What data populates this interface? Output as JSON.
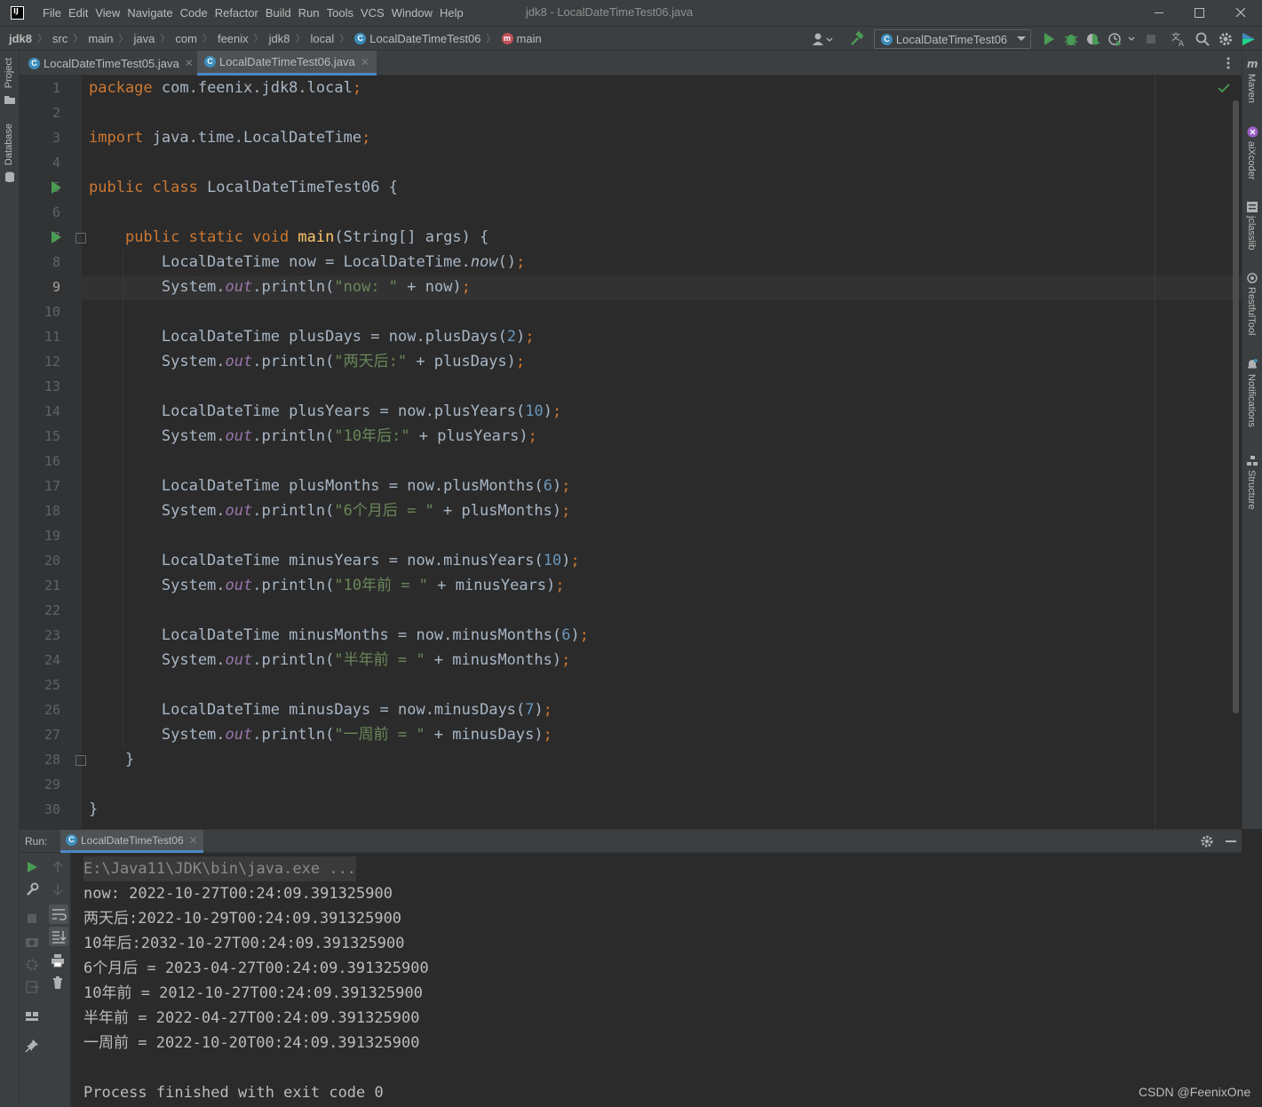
{
  "window": {
    "title": "jdk8 - LocalDateTimeTest06.java",
    "logo_text": "IJ"
  },
  "menu": [
    "File",
    "Edit",
    "View",
    "Navigate",
    "Code",
    "Refactor",
    "Build",
    "Run",
    "Tools",
    "VCS",
    "Window",
    "Help"
  ],
  "breadcrumb": [
    "jdk8",
    "src",
    "main",
    "java",
    "com",
    "feenix",
    "jdk8",
    "local",
    "LocalDateTimeTest06",
    "main"
  ],
  "toolbar": {
    "run_config": "LocalDateTimeTest06"
  },
  "left_tools": [
    "Project",
    "Database"
  ],
  "right_tools": [
    "Maven",
    "aiXcoder",
    "jclasslib",
    "RestfulTool",
    "Notifications",
    "Structure"
  ],
  "tabs": [
    {
      "label": "LocalDateTimeTest05.java",
      "active": false
    },
    {
      "label": "LocalDateTimeTest06.java",
      "active": true
    }
  ],
  "editor": {
    "current_line": 9,
    "line_numbers": [
      "1",
      "2",
      "3",
      "4",
      "5",
      "6",
      "7",
      "8",
      "9",
      "10",
      "11",
      "12",
      "13",
      "14",
      "15",
      "16",
      "17",
      "18",
      "19",
      "20",
      "21",
      "22",
      "23",
      "24",
      "25",
      "26",
      "27",
      "28",
      "29",
      "30"
    ],
    "lines": [
      [
        [
          "kw",
          "package "
        ],
        [
          "pl",
          "com.feenix.jdk8.local"
        ],
        [
          "kw",
          ";"
        ]
      ],
      [],
      [
        [
          "kw",
          "import "
        ],
        [
          "pl",
          "java.time.LocalDateTime"
        ],
        [
          "kw",
          ";"
        ]
      ],
      [],
      [
        [
          "kw",
          "public class "
        ],
        [
          "pl",
          "LocalDateTimeTest06 {"
        ]
      ],
      [],
      [
        [
          "pl",
          "    "
        ],
        [
          "kw",
          "public static void "
        ],
        [
          "fn",
          "main"
        ],
        [
          "pl",
          "(String[] args) {"
        ]
      ],
      [
        [
          "pl",
          "        LocalDateTime now = LocalDateTime."
        ],
        [
          "sm",
          "now"
        ],
        [
          "pl",
          "()"
        ],
        [
          "kw",
          ";"
        ]
      ],
      [
        [
          "pl",
          "        System."
        ],
        [
          "it",
          "out"
        ],
        [
          "pl",
          ".println("
        ],
        [
          "st",
          "\"now: \""
        ],
        [
          "pl",
          " + now)"
        ],
        [
          "kw",
          ";"
        ]
      ],
      [],
      [
        [
          "pl",
          "        LocalDateTime plusDays = now.plusDays("
        ],
        [
          "num",
          "2"
        ],
        [
          "pl",
          ")"
        ],
        [
          "kw",
          ";"
        ]
      ],
      [
        [
          "pl",
          "        System."
        ],
        [
          "it",
          "out"
        ],
        [
          "pl",
          ".println("
        ],
        [
          "st",
          "\"两天后:\""
        ],
        [
          "pl",
          " + plusDays)"
        ],
        [
          "kw",
          ";"
        ]
      ],
      [],
      [
        [
          "pl",
          "        LocalDateTime plusYears = now.plusYears("
        ],
        [
          "num",
          "10"
        ],
        [
          "pl",
          ")"
        ],
        [
          "kw",
          ";"
        ]
      ],
      [
        [
          "pl",
          "        System."
        ],
        [
          "it",
          "out"
        ],
        [
          "pl",
          ".println("
        ],
        [
          "st",
          "\"10年后:\""
        ],
        [
          "pl",
          " + plusYears)"
        ],
        [
          "kw",
          ";"
        ]
      ],
      [],
      [
        [
          "pl",
          "        LocalDateTime plusMonths = now.plusMonths("
        ],
        [
          "num",
          "6"
        ],
        [
          "pl",
          ")"
        ],
        [
          "kw",
          ";"
        ]
      ],
      [
        [
          "pl",
          "        System."
        ],
        [
          "it",
          "out"
        ],
        [
          "pl",
          ".println("
        ],
        [
          "st",
          "\"6个月后 = \""
        ],
        [
          "pl",
          " + plusMonths)"
        ],
        [
          "kw",
          ";"
        ]
      ],
      [],
      [
        [
          "pl",
          "        LocalDateTime minusYears = now.minusYears("
        ],
        [
          "num",
          "10"
        ],
        [
          "pl",
          ")"
        ],
        [
          "kw",
          ";"
        ]
      ],
      [
        [
          "pl",
          "        System."
        ],
        [
          "it",
          "out"
        ],
        [
          "pl",
          ".println("
        ],
        [
          "st",
          "\"10年前 = \""
        ],
        [
          "pl",
          " + minusYears)"
        ],
        [
          "kw",
          ";"
        ]
      ],
      [],
      [
        [
          "pl",
          "        LocalDateTime minusMonths = now.minusMonths("
        ],
        [
          "num",
          "6"
        ],
        [
          "pl",
          ")"
        ],
        [
          "kw",
          ";"
        ]
      ],
      [
        [
          "pl",
          "        System."
        ],
        [
          "it",
          "out"
        ],
        [
          "pl",
          ".println("
        ],
        [
          "st",
          "\"半年前 = \""
        ],
        [
          "pl",
          " + minusMonths)"
        ],
        [
          "kw",
          ";"
        ]
      ],
      [],
      [
        [
          "pl",
          "        LocalDateTime minusDays = now.minusDays("
        ],
        [
          "num",
          "7"
        ],
        [
          "pl",
          ")"
        ],
        [
          "kw",
          ";"
        ]
      ],
      [
        [
          "pl",
          "        System."
        ],
        [
          "it",
          "out"
        ],
        [
          "pl",
          ".println("
        ],
        [
          "st",
          "\"一周前 = \""
        ],
        [
          "pl",
          " + minusDays)"
        ],
        [
          "kw",
          ";"
        ]
      ],
      [
        [
          "pl",
          "    }"
        ]
      ],
      [],
      [
        [
          "pl",
          "}"
        ]
      ]
    ]
  },
  "run_panel": {
    "label": "Run:",
    "tab": "LocalDateTimeTest06",
    "output": [
      "E:\\Java11\\JDK\\bin\\java.exe ...",
      "now: 2022-10-27T00:24:09.391325900",
      "两天后:2022-10-29T00:24:09.391325900",
      "10年后:2032-10-27T00:24:09.391325900",
      "6个月后 = 2023-04-27T00:24:09.391325900",
      "10年前 = 2012-10-27T00:24:09.391325900",
      "半年前 = 2022-04-27T00:24:09.391325900",
      "一周前 = 2022-10-20T00:24:09.391325900",
      "",
      "Process finished with exit code 0"
    ]
  },
  "watermark": "CSDN @FeenixOne",
  "colors": {
    "keyword": "#cc7832",
    "string": "#6a8759",
    "number": "#6897bb",
    "function": "#ffc66d",
    "static_field": "#9876aa",
    "run_green": "#499c54",
    "accent": "#4a88c7"
  }
}
